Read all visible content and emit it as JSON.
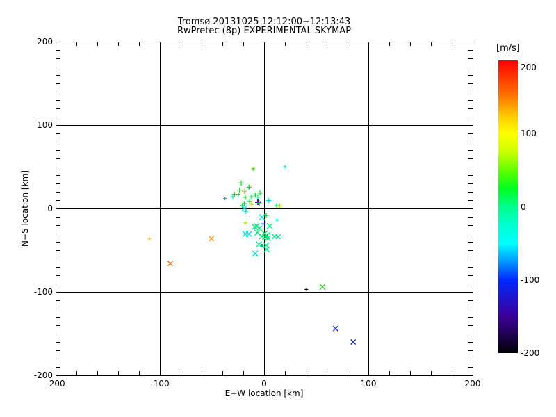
{
  "chart_data": {
    "type": "scatter",
    "title": "Tromsø 20131025 12:12:00−12:13:43",
    "subtitle": "RwPretec (8p) EXPERIMENTAL SKYMAP",
    "xlabel": "E−W location [km]",
    "ylabel": "N−S location [km]",
    "xlim": [
      -200,
      200
    ],
    "ylim": [
      -200,
      200
    ],
    "xticks": [
      -200,
      -100,
      0,
      100,
      200
    ],
    "xtick_labels": [
      "-200",
      "-100",
      "0",
      "100",
      "200"
    ],
    "yticks": [
      -200,
      -100,
      0,
      100,
      200
    ],
    "ytick_labels": [
      "-200",
      "-100",
      "0",
      "100",
      "200"
    ],
    "x_minor_step": 20,
    "y_minor_step": 10,
    "grid": true,
    "axis_color": "#000000",
    "background_color": "#ffffff",
    "marker_legend": "color encodes Doppler velocity in m/s per colorbar",
    "points": [
      {
        "x": -10.5,
        "y": 47.5,
        "c": "#3ce000",
        "m": "p",
        "s": 2
      },
      {
        "x": 20,
        "y": 50,
        "c": "#00e0e0",
        "m": "p",
        "s": 2
      },
      {
        "x": -22,
        "y": 30.5,
        "c": "#00d822",
        "m": "p"
      },
      {
        "x": -14.5,
        "y": 25.5,
        "c": "#00d822",
        "m": "p"
      },
      {
        "x": -23.5,
        "y": 22,
        "c": "#00d822",
        "m": "p"
      },
      {
        "x": -19,
        "y": 20.5,
        "c": "#a8e000",
        "m": "p"
      },
      {
        "x": -28.5,
        "y": 17,
        "c": "#00d822",
        "m": "p"
      },
      {
        "x": -24.5,
        "y": 17,
        "c": "#22cc66",
        "m": "p",
        "s": 2
      },
      {
        "x": -30,
        "y": 14,
        "c": "#00e0e0",
        "m": "p"
      },
      {
        "x": -37.5,
        "y": 12,
        "c": "#2a8cee",
        "m": "p",
        "s": 2
      },
      {
        "x": -18,
        "y": 13.5,
        "c": "#00d822",
        "m": "p"
      },
      {
        "x": -12.5,
        "y": 14,
        "c": "#00ef87",
        "m": "p"
      },
      {
        "x": -8.5,
        "y": 16,
        "c": "#00d822",
        "m": "p"
      },
      {
        "x": -6,
        "y": 13.5,
        "c": "#00ef87",
        "m": "p"
      },
      {
        "x": -4,
        "y": 18.5,
        "c": "#00d822",
        "m": "p"
      },
      {
        "x": 4.5,
        "y": 9.5,
        "c": "#00e0e0",
        "m": "p"
      },
      {
        "x": -6,
        "y": 7.5,
        "c": "#5a00aa",
        "m": "p",
        "w": 2
      },
      {
        "x": -4.5,
        "y": 6.5,
        "c": "#00d822",
        "m": "p"
      },
      {
        "x": -19,
        "y": 6,
        "c": "#00d822",
        "m": "p"
      },
      {
        "x": -12,
        "y": 5,
        "c": "#a8e000",
        "m": "p"
      },
      {
        "x": -21,
        "y": 3.5,
        "c": "#00d822",
        "m": "p"
      },
      {
        "x": 12,
        "y": 3.5,
        "c": "#00ef87",
        "m": "p"
      },
      {
        "x": 15,
        "y": 3,
        "c": "#a8e000",
        "m": "p"
      },
      {
        "x": -14,
        "y": 8.5,
        "c": "#00d822",
        "m": "p"
      },
      {
        "x": -17.5,
        "y": -3.5,
        "c": "#00e0e0",
        "m": "p"
      },
      {
        "x": 2,
        "y": -8.5,
        "c": "#00d822",
        "m": "p"
      },
      {
        "x": -110,
        "y": -36.5,
        "c": "#ffc400",
        "m": "p",
        "s": 2
      },
      {
        "x": 12.5,
        "y": -14,
        "c": "#00e0e0",
        "m": "p",
        "s": 2
      },
      {
        "x": -18,
        "y": -17.5,
        "c": "#a8e000",
        "m": "p",
        "s": 2
      },
      {
        "x": -1,
        "y": -18.5,
        "c": "#2244cc",
        "m": "p",
        "s": 2
      },
      {
        "x": 40.5,
        "y": -97,
        "c": "#101010",
        "m": "p",
        "s": 2
      },
      {
        "x": -19,
        "y": 0,
        "c": "#00e0e0",
        "m": "x"
      },
      {
        "x": -2,
        "y": -10.5,
        "c": "#00e0e0",
        "m": "x"
      },
      {
        "x": -7,
        "y": -21.5,
        "c": "#00ef87",
        "m": "x"
      },
      {
        "x": -9,
        "y": -22,
        "c": "#00ef87",
        "m": "x",
        "s": 3
      },
      {
        "x": -4.5,
        "y": -23.5,
        "c": "#00ef87",
        "m": "x",
        "s": 3
      },
      {
        "x": 5.5,
        "y": -21,
        "c": "#00ef87",
        "m": "x"
      },
      {
        "x": -18,
        "y": -30.5,
        "c": "#00e0e0",
        "m": "x"
      },
      {
        "x": -14.5,
        "y": -30.5,
        "c": "#00e0e0",
        "m": "x"
      },
      {
        "x": -6.5,
        "y": -29,
        "c": "#00ef87",
        "m": "x"
      },
      {
        "x": 0.5,
        "y": -30,
        "c": "#00d844",
        "m": "x"
      },
      {
        "x": 2.5,
        "y": -32.5,
        "c": "#00ef87",
        "m": "x",
        "s": 4
      },
      {
        "x": 1,
        "y": -34,
        "c": "#00c040",
        "m": "x"
      },
      {
        "x": -2,
        "y": -33.5,
        "c": "#00ef87",
        "m": "x"
      },
      {
        "x": 3.5,
        "y": -35.5,
        "c": "#00ef87",
        "m": "x"
      },
      {
        "x": 10,
        "y": -33.5,
        "c": "#00ef87",
        "m": "x",
        "s": 3
      },
      {
        "x": 13.5,
        "y": -34,
        "c": "#00ef87",
        "m": "x",
        "s": 3
      },
      {
        "x": -5,
        "y": -43,
        "c": "#00ef87",
        "m": "x"
      },
      {
        "x": 2,
        "y": -44,
        "c": "#00ef87",
        "m": "x"
      },
      {
        "x": -2,
        "y": -44.5,
        "c": "#00bb77",
        "m": "d"
      },
      {
        "x": 2.5,
        "y": -49,
        "c": "#00ef87",
        "m": "x"
      },
      {
        "x": -8.5,
        "y": -54,
        "c": "#00e0e0",
        "m": "x"
      },
      {
        "x": -50.5,
        "y": -36,
        "c": "#ff9022",
        "m": "x",
        "s": 3
      },
      {
        "x": -90,
        "y": -66,
        "c": "#ee7711",
        "m": "x",
        "s": 3
      },
      {
        "x": 56,
        "y": -94,
        "c": "#2ed222",
        "m": "x"
      },
      {
        "x": 68.5,
        "y": -144,
        "c": "#2233cc",
        "m": "x",
        "s": 3
      },
      {
        "x": 85.5,
        "y": -160,
        "c": "#2222bb",
        "m": "x",
        "s": 3
      }
    ],
    "colorbar": {
      "label": "[m/s]",
      "min": -200,
      "max": 200,
      "ticks": [
        200,
        100,
        0,
        -100,
        -200
      ],
      "tick_labels": [
        "200",
        "100",
        "0",
        "-100",
        "-200"
      ],
      "gradient": [
        [
          200,
          "#ff0000"
        ],
        [
          150,
          "#ff7800"
        ],
        [
          125,
          "#ffc800"
        ],
        [
          100,
          "#ffff00"
        ],
        [
          75,
          "#c8ff00"
        ],
        [
          50,
          "#64ff00"
        ],
        [
          25,
          "#00ff20"
        ],
        [
          0,
          "#00ff8c"
        ],
        [
          -25,
          "#00ffd2"
        ],
        [
          -50,
          "#00ffff"
        ],
        [
          -75,
          "#0096ff"
        ],
        [
          -100,
          "#0028ff"
        ],
        [
          -150,
          "#3c0096"
        ],
        [
          -175,
          "#1e0050"
        ],
        [
          -200,
          "#000000"
        ]
      ]
    }
  }
}
